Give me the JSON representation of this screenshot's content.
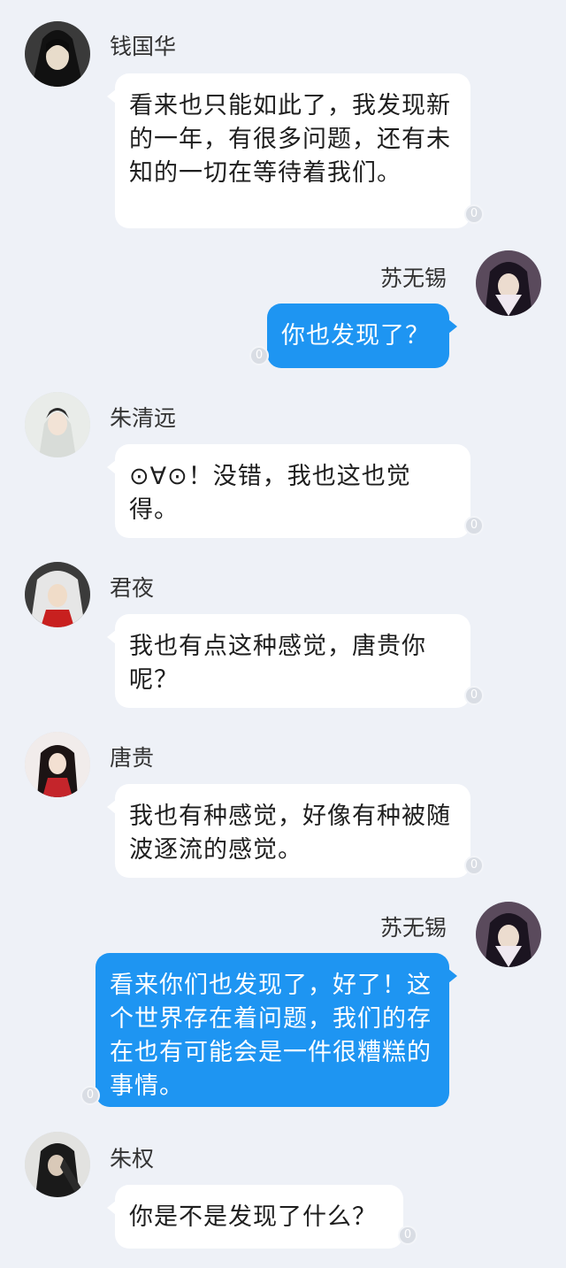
{
  "messages": [
    {
      "sender": "钱国华",
      "text": "看来也只能如此了，我发现新的一年，有很多问题，还有未知的一切在等待着我们。",
      "read_count": "0",
      "outgoing": false
    },
    {
      "sender": "苏无锡",
      "text": "你也发现了？",
      "read_count": "0",
      "outgoing": true
    },
    {
      "sender": "朱清远",
      "text": "⊙∀⊙！没错，我也这也觉得。",
      "read_count": "0",
      "outgoing": false
    },
    {
      "sender": "君夜",
      "text": "我也有点这种感觉，唐贵你呢？",
      "read_count": "0",
      "outgoing": false
    },
    {
      "sender": "唐贵",
      "text": "我也有种感觉，好像有种被随波逐流的感觉。",
      "read_count": "0",
      "outgoing": false
    },
    {
      "sender": "苏无锡",
      "text": "看来你们也发现了，好了！这个世界存在着问题，我们的存在也有可能会是一件很糟糕的事情。",
      "read_count": "0",
      "outgoing": true
    },
    {
      "sender": "朱权",
      "text": "你是不是发现了什么？",
      "read_count": "0",
      "outgoing": false
    }
  ],
  "colors": {
    "background": "#eef1f7",
    "incoming_bubble": "#ffffff",
    "outgoing_bubble": "#1e95f2"
  },
  "icons": {
    "avatar_icon": "avatar-icon",
    "read_receipt_icon": "read-receipt-icon"
  }
}
